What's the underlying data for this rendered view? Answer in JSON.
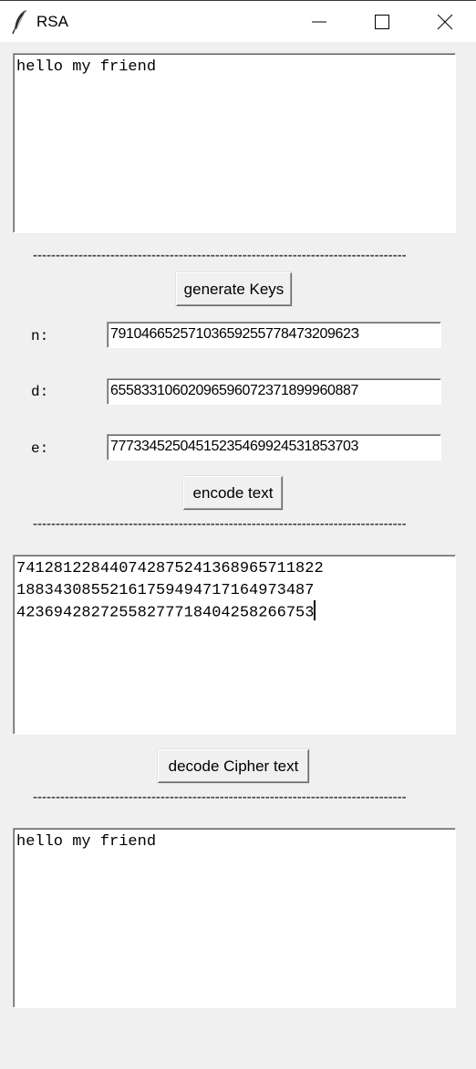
{
  "window": {
    "title": "RSA"
  },
  "plaintext": {
    "value": "hello my friend"
  },
  "separator_text": "----------------------------------------------------------------------------------",
  "buttons": {
    "generate_keys": "generate Keys",
    "encode_text": "encode text",
    "decode_cipher": "decode Cipher text"
  },
  "keys": {
    "n_label": "n:",
    "n_value": "7910466525710365925577847320962З",
    "d_label": "d:",
    "d_value": "6558331060209659607237189996088​7",
    "e_label": "e:",
    "e_value": "7773345250451523546992453185370​3"
  },
  "ciphertext": {
    "lines": [
      "741281228440742875241368965711822",
      "1883430855216175949471716497348​7",
      "4236942827255827771840425826675​3"
    ]
  },
  "decoded": {
    "value": "hello my friend"
  },
  "icons": {
    "app": "feather-icon",
    "minimize": "minimize-icon",
    "maximize": "maximize-icon",
    "close": "close-icon"
  }
}
